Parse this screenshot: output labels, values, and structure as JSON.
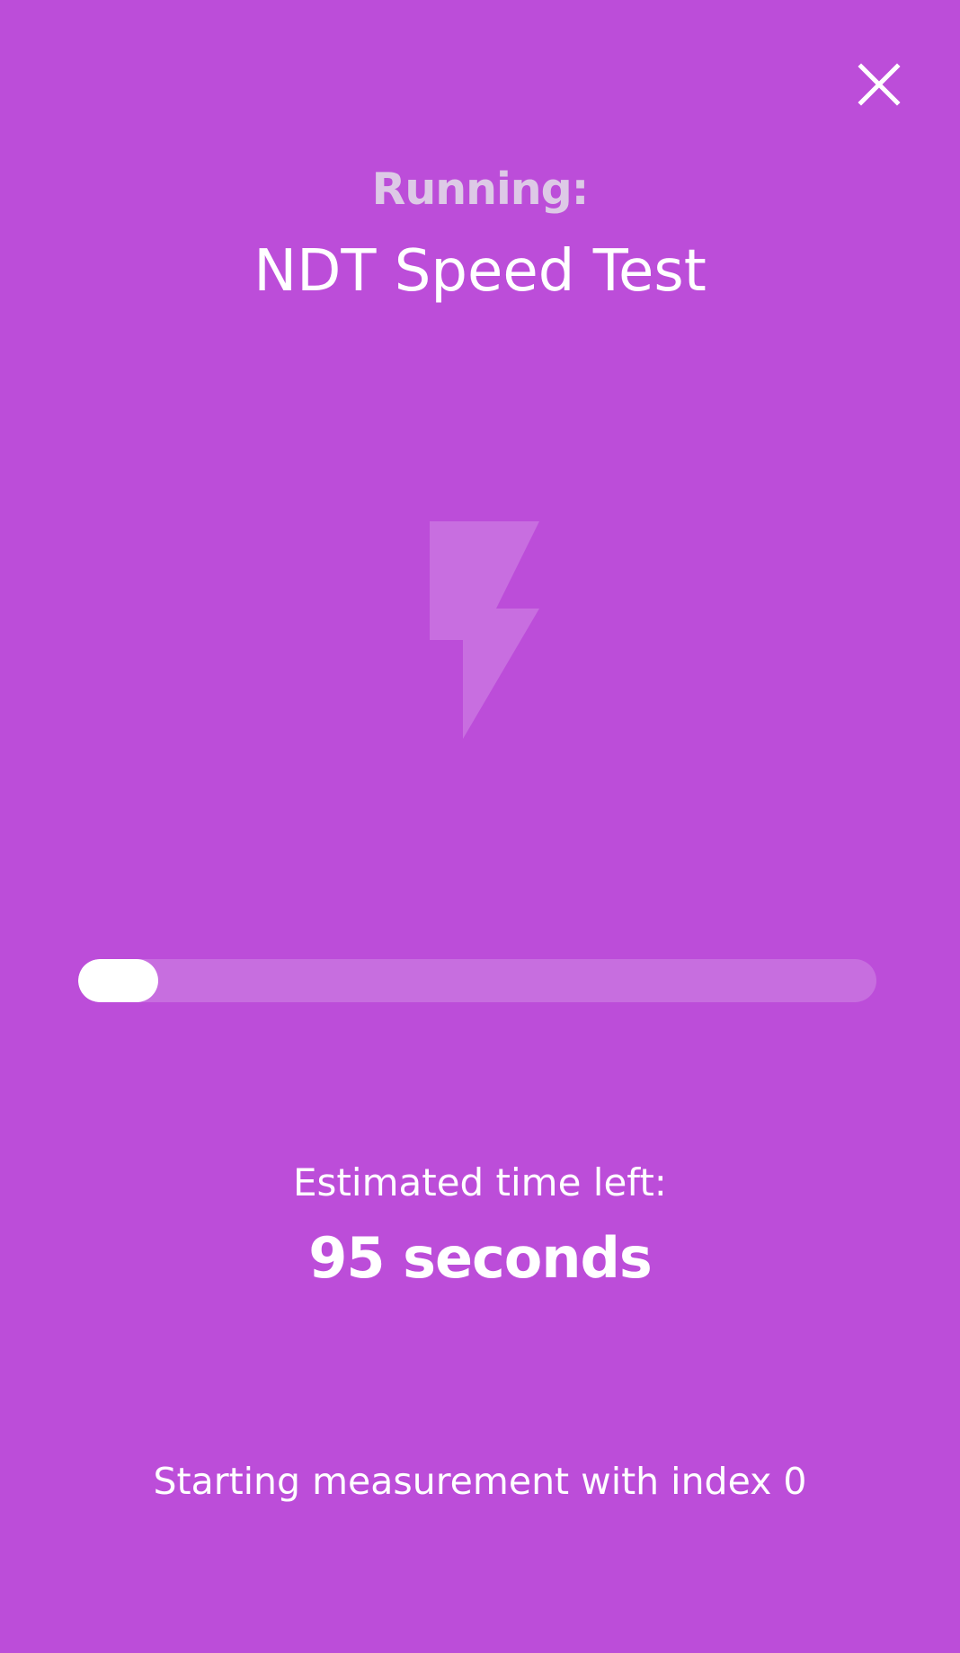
{
  "colors": {
    "background": "#bc4dd9",
    "running_label": "#ddc9e6",
    "progress_track": "#c76edf",
    "progress_fill": "#ffffff",
    "bolt": "#c86ee0"
  },
  "header": {
    "close_icon": "close-icon",
    "running_label": "Running:",
    "test_name": "NDT Speed Test"
  },
  "illustration": {
    "icon": "lightning-bolt-icon"
  },
  "progress": {
    "fraction": 0.1
  },
  "eta": {
    "label": "Estimated time left:",
    "value": "95 seconds"
  },
  "status": {
    "log": "Starting measurement with index 0"
  }
}
